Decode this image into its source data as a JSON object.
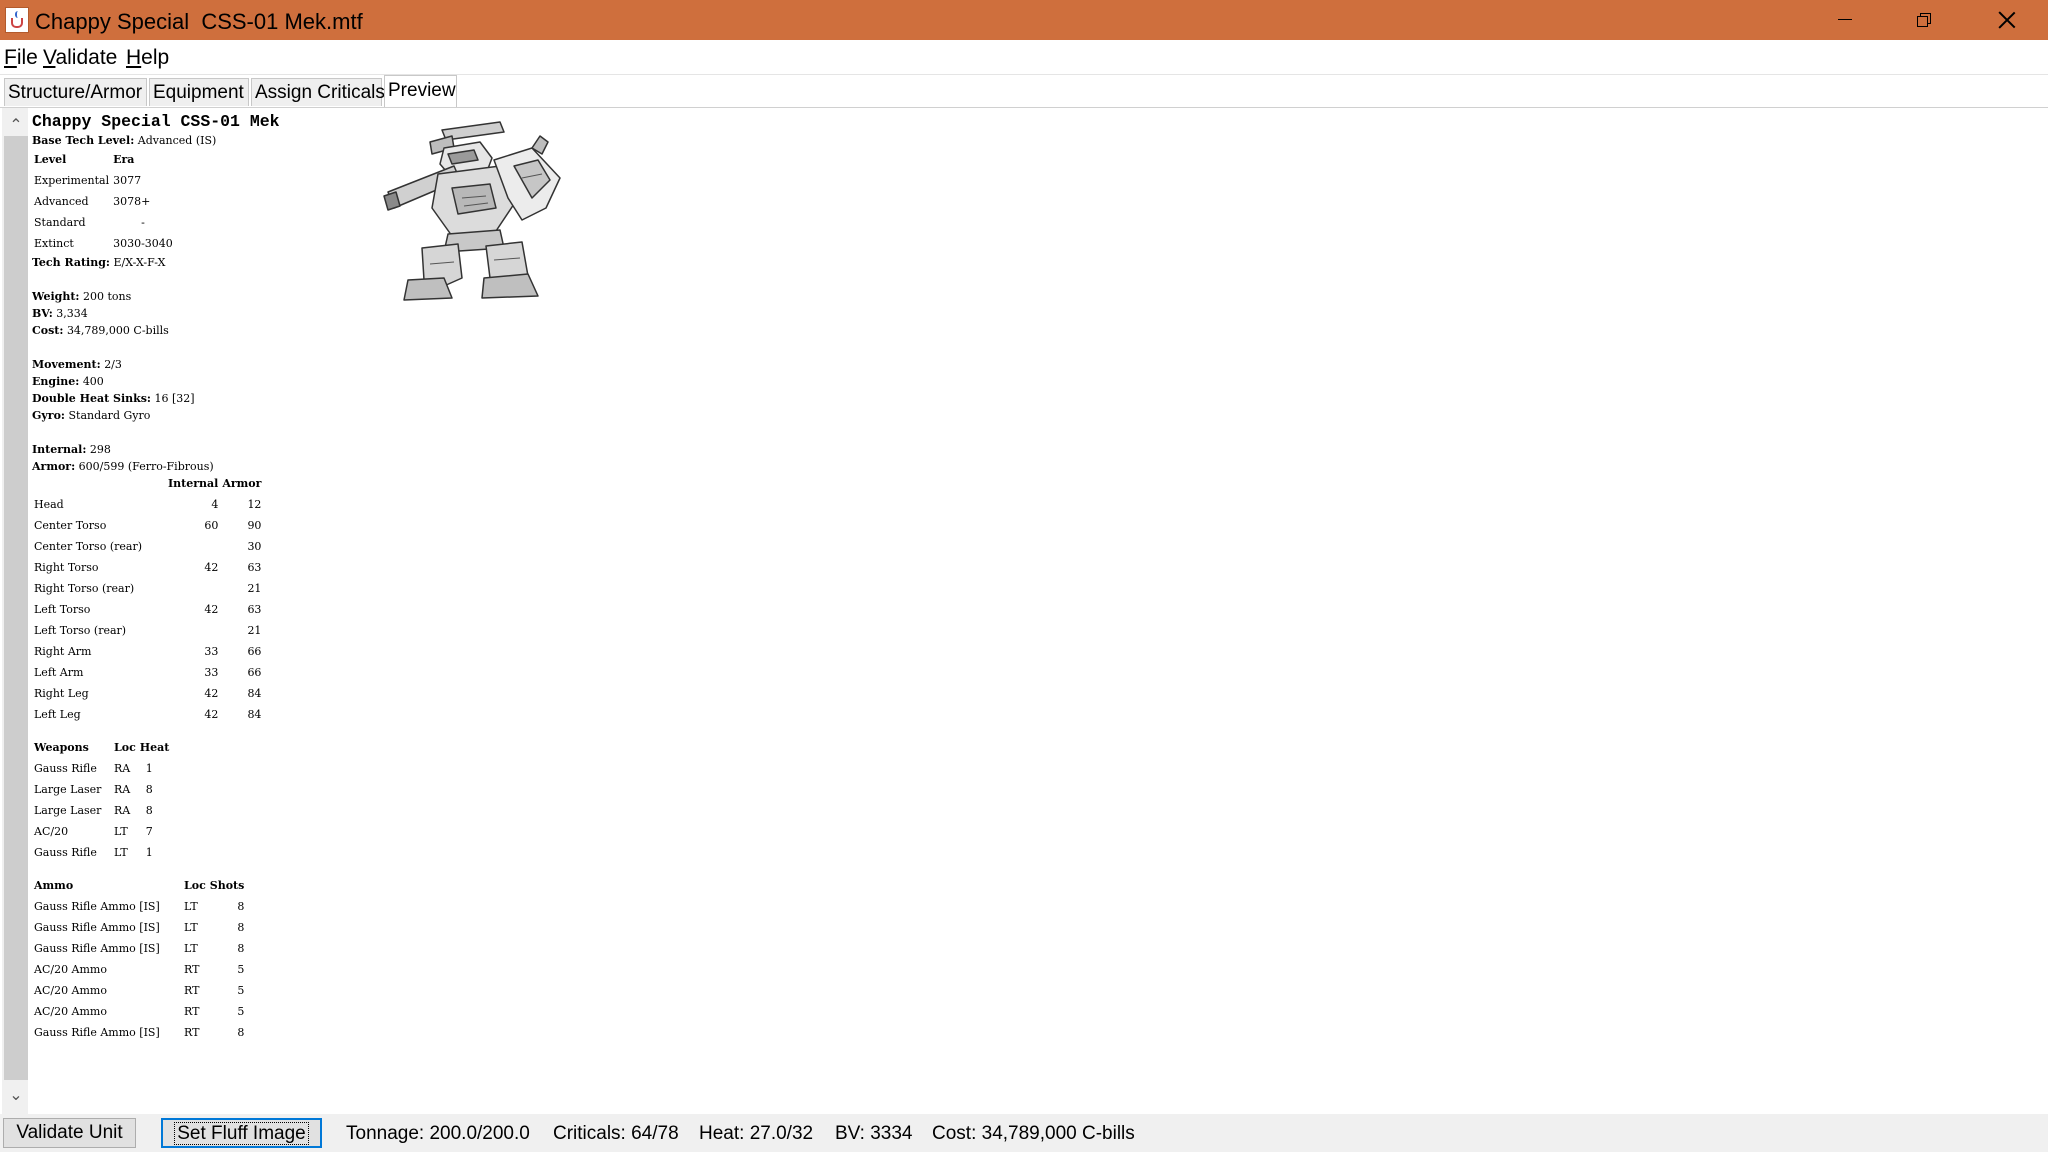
{
  "window": {
    "title": "Chappy Special  CSS-01 Mek.mtf",
    "controls": [
      "minimize-icon",
      "restore-icon",
      "close-icon"
    ]
  },
  "menu": {
    "file_mnemonic": "F",
    "file_rest": "ile",
    "validate_mnemonic": "V",
    "validate_rest": "alidate",
    "help_mnemonic": "H",
    "help_rest": "elp"
  },
  "tabs": [
    "Structure/Armor",
    "Equipment",
    "Assign Criticals",
    "Preview"
  ],
  "active_tab": "Preview",
  "preview": {
    "unit_name": "Chappy Special CSS-01 Mek",
    "base_tech_level_label": "Base Tech Level:",
    "base_tech_level": "Advanced (IS)",
    "tech_table": {
      "headers": [
        "Level",
        "Era"
      ],
      "rows": [
        [
          "Experimental",
          "3077"
        ],
        [
          "Advanced",
          "3078+"
        ],
        [
          "Standard",
          "-"
        ],
        [
          "Extinct",
          "3030-3040"
        ]
      ]
    },
    "tech_rating_label": "Tech Rating:",
    "tech_rating": "E/X-X-F-X",
    "weight_label": "Weight:",
    "weight": "200 tons",
    "bv_label": "BV:",
    "bv": "3,334",
    "cost_label": "Cost:",
    "cost": "34,789,000 C-bills",
    "movement_label": "Movement:",
    "movement": "2/3",
    "engine_label": "Engine:",
    "engine": "400",
    "heat_sinks_label": "Double Heat Sinks:",
    "heat_sinks": "16 [32]",
    "gyro_label": "Gyro:",
    "gyro": "Standard Gyro",
    "internal_label": "Internal:",
    "internal": "298",
    "armor_label": "Armor:",
    "armor": "600/599 (Ferro-Fibrous)",
    "armor_table": {
      "headers": [
        "",
        "Internal",
        "Armor"
      ],
      "rows": [
        [
          "Head",
          "4",
          "12"
        ],
        [
          "Center Torso",
          "60",
          "90"
        ],
        [
          "Center Torso (rear)",
          "",
          "30"
        ],
        [
          "Right Torso",
          "42",
          "63"
        ],
        [
          "Right Torso (rear)",
          "",
          "21"
        ],
        [
          "Left Torso",
          "42",
          "63"
        ],
        [
          "Left Torso (rear)",
          "",
          "21"
        ],
        [
          "Right Arm",
          "33",
          "66"
        ],
        [
          "Left Arm",
          "33",
          "66"
        ],
        [
          "Right Leg",
          "42",
          "84"
        ],
        [
          "Left Leg",
          "42",
          "84"
        ]
      ]
    },
    "weapons_table": {
      "headers": [
        "Weapons",
        "Loc",
        "Heat"
      ],
      "rows": [
        [
          "Gauss Rifle",
          "RA",
          "1"
        ],
        [
          "Large Laser",
          "RA",
          "8"
        ],
        [
          "Large Laser",
          "RA",
          "8"
        ],
        [
          "AC/20",
          "LT",
          "7"
        ],
        [
          "Gauss Rifle",
          "LT",
          "1"
        ]
      ]
    },
    "ammo_table": {
      "headers": [
        "Ammo",
        "Loc",
        "Shots"
      ],
      "rows": [
        [
          "Gauss Rifle Ammo [IS]",
          "LT",
          "8"
        ],
        [
          "Gauss Rifle Ammo [IS]",
          "LT",
          "8"
        ],
        [
          "Gauss Rifle Ammo [IS]",
          "LT",
          "8"
        ],
        [
          "AC/20 Ammo",
          "RT",
          "5"
        ],
        [
          "AC/20 Ammo",
          "RT",
          "5"
        ],
        [
          "AC/20 Ammo",
          "RT",
          "5"
        ],
        [
          "Gauss Rifle Ammo [IS]",
          "RT",
          "8"
        ]
      ]
    }
  },
  "statusbar": {
    "validate_button": "Validate Unit",
    "fluff_button": "Set Fluff Image",
    "tonnage": "Tonnage: 200.0/200.0",
    "criticals": "Criticals: 64/78",
    "heat": "Heat: 27.0/32",
    "bv": "BV: 3334",
    "cost": "Cost: 34,789,000 C-bills"
  }
}
